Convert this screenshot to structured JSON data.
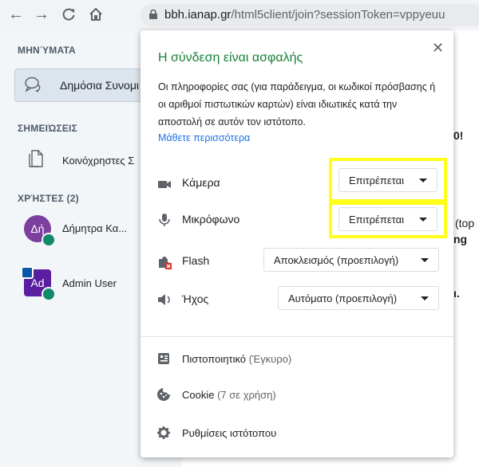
{
  "browser": {
    "url_host": "bbh.ianap.gr",
    "url_path": "/html5client/join?sessionToken=vppyeuu"
  },
  "sidebar": {
    "messages_title": "ΜΗΝΎΜΑΤΑ",
    "public_chat_label": "Δημόσια Συνομι",
    "notes_title": "ΣΗΜΕΙΏΣΕΙΣ",
    "shared_notes_label": "Κοινόχρηστες Σ",
    "users_title": "ΧΡΉΣΤΕΣ (2)",
    "users": [
      {
        "initials": "Δή",
        "name": "Δήμητρα Κα...",
        "color": "#7b3f9e"
      },
      {
        "initials": "Ad",
        "name": "Admin User",
        "color": "#5a1fa0"
      }
    ]
  },
  "background_fragments": [
    "0!",
    "(top",
    "ng",
    "ı."
  ],
  "popup": {
    "title": "Η σύνδεση είναι ασφαλής",
    "description": "Οι πληροφορίες σας (για παράδειγμα, οι κωδικοί πρόσβασης ή οι αριθμοί πιστωτικών καρτών) είναι ιδιωτικές κατά την αποστολή σε αυτόν τον ιστότοπο.",
    "learn_more": "Μάθετε περισσότερα",
    "close_symbol": "✕",
    "permissions": [
      {
        "icon": "camera-icon",
        "label": "Κάμερα",
        "value": "Επιτρέπεται"
      },
      {
        "icon": "microphone-icon",
        "label": "Μικρόφωνο",
        "value": "Επιτρέπεται"
      },
      {
        "icon": "flash-blocked-icon",
        "label": "Flash",
        "value": "Αποκλεισμός (προεπιλογή)"
      },
      {
        "icon": "sound-icon",
        "label": "Ήχος",
        "value": "Αυτόματο (προεπιλογή)"
      }
    ],
    "footer": {
      "certificate_label": "Πιστοποιητικό",
      "certificate_status": "(Έγκυρο)",
      "cookie_label": "Cookie",
      "cookie_status": "(7 σε χρήση)",
      "site_settings_label": "Ρυθμίσεις ιστότοπου"
    },
    "highlight_color": "#ffff1a",
    "title_color": "#188038",
    "link_color": "#1a73e8"
  }
}
